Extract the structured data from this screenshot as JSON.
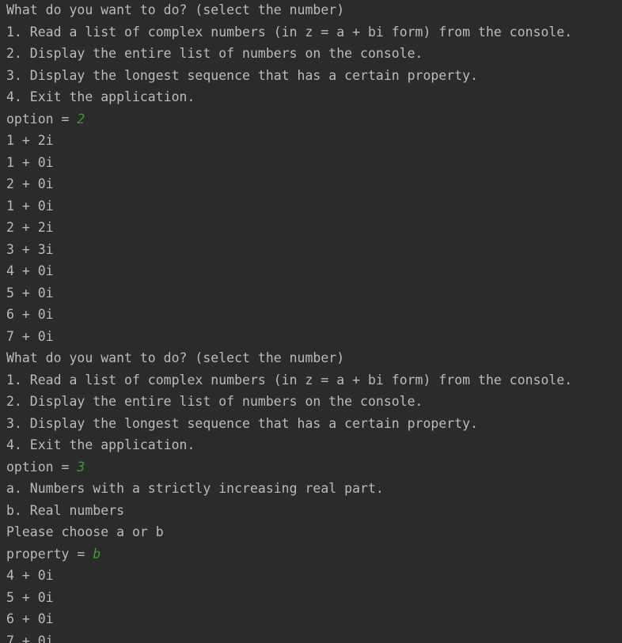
{
  "console": {
    "lines": [
      {
        "text": "What do you want to do? (select the number)"
      },
      {
        "text": "1. Read a list of complex numbers (in z = a + bi form) from the console."
      },
      {
        "text": "2. Display the entire list of numbers on the console."
      },
      {
        "text": "3. Display the longest sequence that has a certain property."
      },
      {
        "text": "4. Exit the application."
      },
      {
        "text": "option = ",
        "input": "2"
      },
      {
        "text": "1 + 2i"
      },
      {
        "text": "1 + 0i"
      },
      {
        "text": "2 + 0i"
      },
      {
        "text": "1 + 0i"
      },
      {
        "text": "2 + 2i"
      },
      {
        "text": "3 + 3i"
      },
      {
        "text": "4 + 0i"
      },
      {
        "text": "5 + 0i"
      },
      {
        "text": "6 + 0i"
      },
      {
        "text": "7 + 0i"
      },
      {
        "text": "What do you want to do? (select the number)"
      },
      {
        "text": "1. Read a list of complex numbers (in z = a + bi form) from the console."
      },
      {
        "text": "2. Display the entire list of numbers on the console."
      },
      {
        "text": "3. Display the longest sequence that has a certain property."
      },
      {
        "text": "4. Exit the application."
      },
      {
        "text": "option = ",
        "input": "3"
      },
      {
        "text": "a. Numbers with a strictly increasing real part."
      },
      {
        "text": "b. Real numbers"
      },
      {
        "text": "Please choose a or b"
      },
      {
        "text": "property = ",
        "input": "b"
      },
      {
        "text": "4 + 0i"
      },
      {
        "text": "5 + 0i"
      },
      {
        "text": "6 + 0i"
      },
      {
        "text": "7 + 0i"
      }
    ]
  }
}
